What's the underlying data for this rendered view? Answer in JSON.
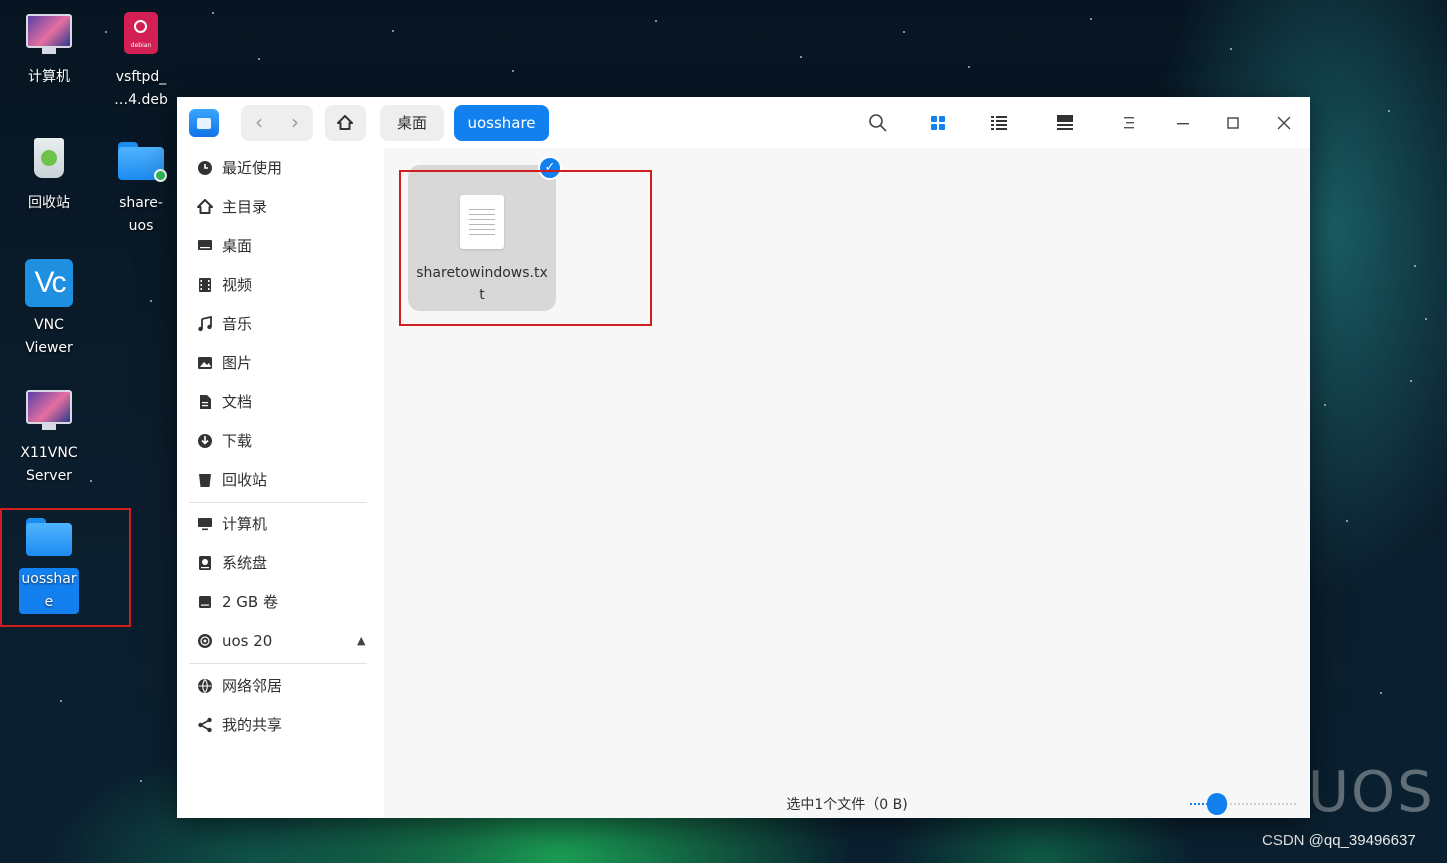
{
  "desktop": {
    "icons": [
      {
        "label": "计算机"
      },
      {
        "label": "vsftpd_\n…4.deb",
        "deb_text": "debian"
      },
      {
        "label": "回收站"
      },
      {
        "label": "share-\nuos"
      },
      {
        "label": "VNC\nViewer",
        "glyph": "Vc"
      },
      {
        "label": "X11VNC\nServer"
      },
      {
        "label": "uosshar\ne"
      }
    ],
    "brand": "UOS",
    "watermark": "CSDN @qq_39496637"
  },
  "window": {
    "breadcrumb": [
      "桌面",
      "uosshare"
    ],
    "nav_back": "‹",
    "nav_forward": "›",
    "toolbar_icons": [
      "search-icon",
      "icon-view-icon",
      "list-view-icon",
      "detail-view-icon",
      "menu-icon",
      "minimize-icon",
      "maximize-icon",
      "close-icon"
    ],
    "sidebar": {
      "group1": [
        {
          "label": "最近使用",
          "icon": "clock-icon"
        },
        {
          "label": "主目录",
          "icon": "home-icon"
        },
        {
          "label": "桌面",
          "icon": "desktop-icon"
        },
        {
          "label": "视频",
          "icon": "video-icon"
        },
        {
          "label": "音乐",
          "icon": "music-icon"
        },
        {
          "label": "图片",
          "icon": "picture-icon"
        },
        {
          "label": "文档",
          "icon": "document-icon"
        },
        {
          "label": "下载",
          "icon": "download-icon"
        },
        {
          "label": "回收站",
          "icon": "trash-icon"
        }
      ],
      "group2": [
        {
          "label": "计算机",
          "icon": "computer-icon"
        },
        {
          "label": "系统盘",
          "icon": "system-disk-icon"
        },
        {
          "label": "2 GB 卷",
          "icon": "volume-icon"
        },
        {
          "label": "uos 20",
          "icon": "optical-disc-icon",
          "eject": "▲"
        }
      ],
      "group3": [
        {
          "label": "网络邻居",
          "icon": "network-icon"
        },
        {
          "label": "我的共享",
          "icon": "share-icon"
        }
      ]
    },
    "files": [
      {
        "name": "sharetowindows.txt",
        "selected": true,
        "check": "✓"
      }
    ],
    "status": "选中1个文件（0 B)",
    "icon_size_level": 0.25
  },
  "colors": {
    "accent": "#1380f0",
    "highlight_box": "#d01d1d"
  }
}
